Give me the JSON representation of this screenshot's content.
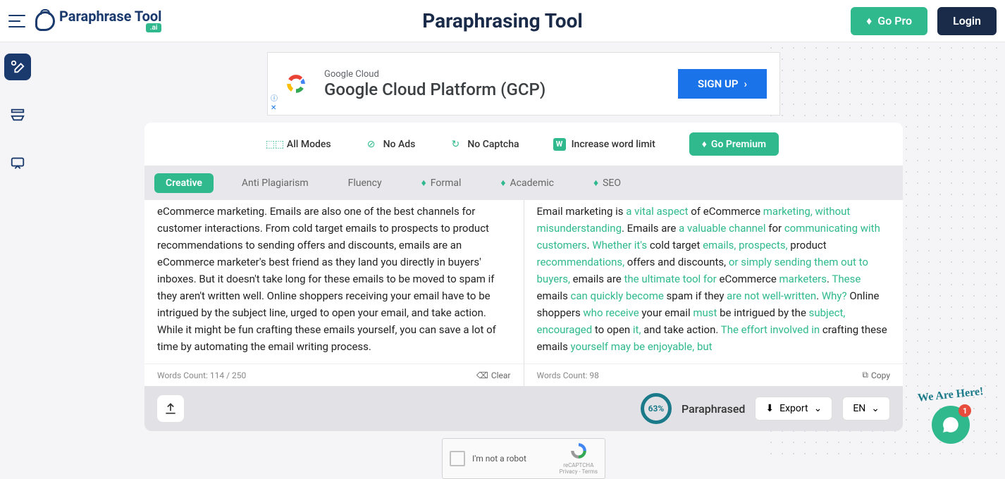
{
  "header": {
    "logo_text": "Paraphrase Tool",
    "logo_badge": ".ai",
    "title": "Paraphrasing Tool",
    "go_pro": "Go Pro",
    "login": "Login"
  },
  "ad": {
    "brand": "Google Cloud",
    "headline": "Google Cloud Platform (GCP)",
    "cta": "SIGN UP"
  },
  "premium_bar": {
    "all_modes": "All Modes",
    "no_ads": "No Ads",
    "no_captcha": "No Captcha",
    "word_limit": "Increase word limit",
    "cta": "Go Premium"
  },
  "modes": {
    "creative": "Creative",
    "anti_plag": "Anti Plagiarism",
    "fluency": "Fluency",
    "formal": "Formal",
    "academic": "Academic",
    "seo": "SEO"
  },
  "input": {
    "text": "eCommerce marketing. Emails are also one of the best channels for customer interactions. From cold target emails to prospects to product recommendations to sending offers and discounts, emails are an eCommerce marketer's best friend as they land you directly in buyers' inboxes. But it doesn't take long for these emails to be moved to spam if they aren't written well. Online shoppers receiving your email have to be intrigued by the subject line, urged to open your email, and take action. While it might be fun crafting these emails yourself, you can save a lot of time by automating the email writing process.",
    "word_count": "Words Count: 114 / 250",
    "clear": "Clear"
  },
  "output": {
    "word_count": "Words Count: 98",
    "copy": "Copy"
  },
  "bottom": {
    "progress": "63%",
    "paraphrased": "Paraphrased",
    "export": "Export",
    "lang": "EN"
  },
  "recaptcha": {
    "label": "I'm not a robot",
    "brand": "reCAPTCHA",
    "terms": "Privacy - Terms"
  },
  "help": {
    "text": "We Are Here!",
    "badge": "1"
  }
}
